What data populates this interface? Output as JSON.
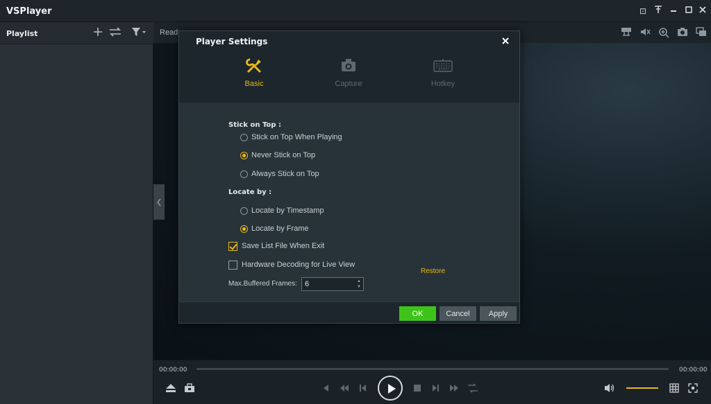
{
  "app": {
    "title": "VSPlayer"
  },
  "window_controls": [
    {
      "name": "menu-icon",
      "glyph": "⊡"
    },
    {
      "name": "pin-icon",
      "glyph": "⊥"
    },
    {
      "name": "minimize-icon",
      "glyph": "—"
    },
    {
      "name": "maximize-icon",
      "glyph": "□"
    },
    {
      "name": "close-icon",
      "glyph": "✕"
    }
  ],
  "playlist": {
    "title": "Playlist",
    "add_icon": "+",
    "order_icon": "⇆",
    "filter_icon": "▼"
  },
  "main": {
    "status_text": "Read"
  },
  "dialog": {
    "title": "Player Settings",
    "close_glyph": "✕",
    "tabs": [
      {
        "label": "Basic",
        "icon": "tools-icon",
        "glyph": "✂",
        "active": true
      },
      {
        "label": "Capture",
        "icon": "camera-icon",
        "glyph": "◘",
        "active": false
      },
      {
        "label": "Hotkey",
        "icon": "keyboard-icon",
        "glyph": "⌨",
        "active": false
      }
    ],
    "stick_on_top": {
      "label": "Stick on Top :",
      "options": [
        {
          "label": "Stick on Top When Playing",
          "checked": false
        },
        {
          "label": "Never Stick on Top",
          "checked": true
        },
        {
          "label": "Always Stick on Top",
          "checked": false
        }
      ]
    },
    "locate_by": {
      "label": "Locate by :",
      "options": [
        {
          "label": "Locate by Timestamp",
          "checked": false
        },
        {
          "label": "Locate by Frame",
          "checked": true
        }
      ]
    },
    "save_list": {
      "label": "Save List File When Exit",
      "checked": true
    },
    "hw_decoding": {
      "label": "Hardware Decoding for Live View",
      "checked": false
    },
    "restore_label": "Restore",
    "buffered_frames": {
      "label": "Max.Buffered Frames:",
      "value": "6"
    },
    "buttons": {
      "ok": "OK",
      "cancel": "Cancel",
      "apply": "Apply"
    }
  },
  "controls": {
    "time_start": "00:00:00",
    "time_end": "00:00:00",
    "volume_level": 1.0
  },
  "colors": {
    "accent": "#e8b81c",
    "ok_green": "#3ec419",
    "background": "#1b2227"
  }
}
